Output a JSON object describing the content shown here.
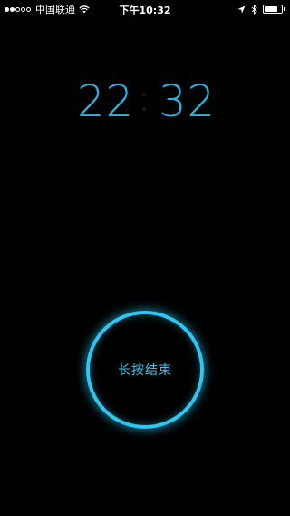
{
  "status_bar": {
    "signal_dots_filled": 2,
    "signal_dots_total": 5,
    "carrier": "中国联通",
    "time": "下午10:32",
    "battery_level": 0.8
  },
  "clock": {
    "hours": "22",
    "minutes": "32"
  },
  "stop_button": {
    "label": "长按结束"
  },
  "colors": {
    "accent": "#2ec6f2",
    "clock_text": "#29b6e6",
    "background": "#000000"
  }
}
